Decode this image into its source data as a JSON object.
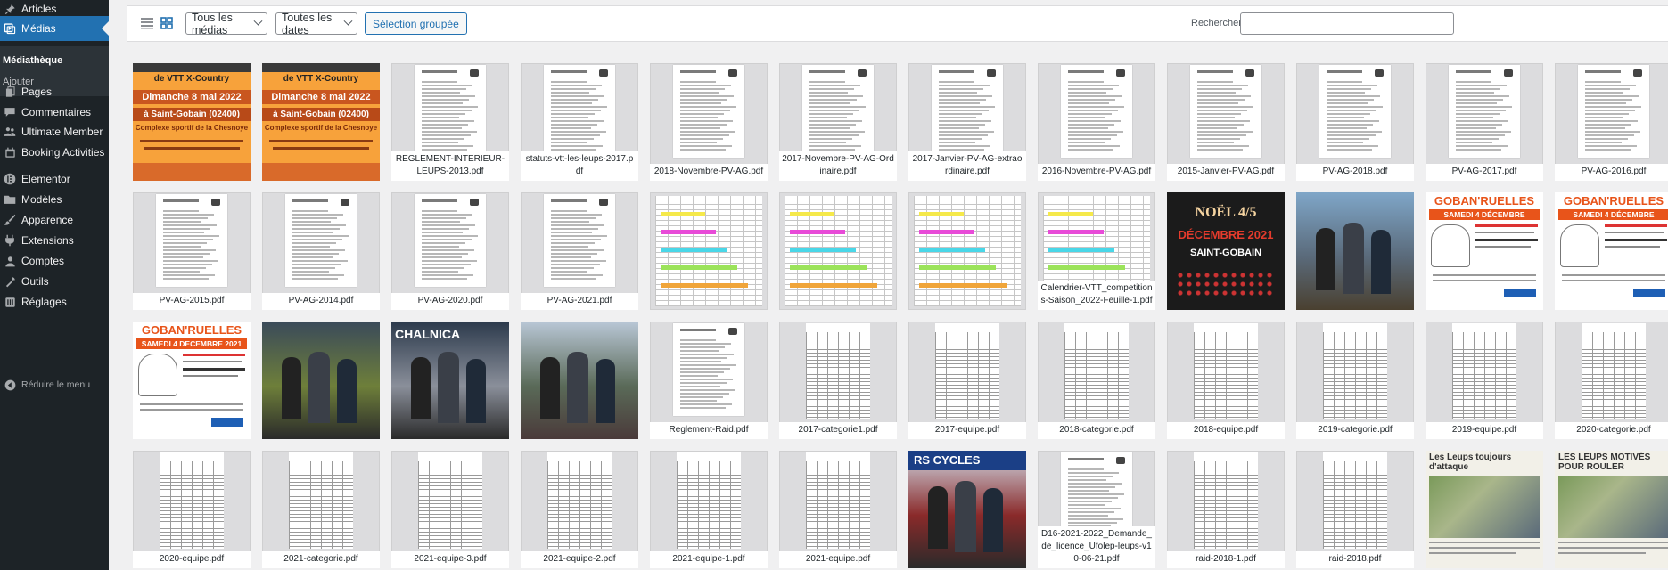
{
  "sidebar": {
    "items": [
      {
        "label": "Articles",
        "icon": "pin-icon",
        "current": false
      },
      {
        "label": "Médias",
        "icon": "media-icon",
        "current": true
      },
      {
        "label": "Pages",
        "icon": "pages-icon",
        "current": false
      },
      {
        "label": "Commentaires",
        "icon": "comments-icon",
        "current": false
      },
      {
        "label": "Ultimate Member",
        "icon": "users-icon",
        "current": false
      },
      {
        "label": "Booking Activities",
        "icon": "calendar-icon",
        "current": false
      },
      {
        "label": "Elementor",
        "icon": "elementor-icon",
        "current": false
      },
      {
        "label": "Modèles",
        "icon": "folder-icon",
        "current": false
      },
      {
        "label": "Apparence",
        "icon": "brush-icon",
        "current": false
      },
      {
        "label": "Extensions",
        "icon": "plugin-icon",
        "current": false
      },
      {
        "label": "Comptes",
        "icon": "user-icon",
        "current": false
      },
      {
        "label": "Outils",
        "icon": "wrench-icon",
        "current": false
      },
      {
        "label": "Réglages",
        "icon": "settings-icon",
        "current": false
      }
    ],
    "submenu": {
      "library": "Médiathèque",
      "add": "Ajouter"
    },
    "collapse": {
      "label": "Réduire le menu",
      "icon": "collapse-icon"
    }
  },
  "toolbar": {
    "type_filter": "Tous les médias",
    "date_filter": "Toutes les dates",
    "bulk_select": "Sélection groupée",
    "search_label": "Rechercher",
    "search_value": ""
  },
  "media": [
    {
      "filename": "",
      "kind": "poster-orange",
      "poster_title": "de VTT X-Country",
      "poster_date": "Dimanche 8 mai 2022",
      "poster_place": "à Saint-Gobain (02400)",
      "poster_sub": "Complexe sportif de la Chesnoye"
    },
    {
      "filename": "",
      "kind": "poster-orange",
      "poster_title": "de VTT X-Country",
      "poster_date": "Dimanche 8 mai 2022",
      "poster_place": "à Saint-Gobain (02400)",
      "poster_sub": "Complexe sportif de la Chesnoye"
    },
    {
      "filename": "REGLEMENT-INTERIEUR-LEUPS-2013.pdf",
      "kind": "doc"
    },
    {
      "filename": "statuts-vtt-les-leups-2017.pdf",
      "kind": "doc"
    },
    {
      "filename": "2018-Novembre-PV-AG.pdf",
      "kind": "doc"
    },
    {
      "filename": "2017-Novembre-PV-AG-Ordinaire.pdf",
      "kind": "doc"
    },
    {
      "filename": "2017-Janvier-PV-AG-extraordinaire.pdf",
      "kind": "doc"
    },
    {
      "filename": "2016-Novembre-PV-AG.pdf",
      "kind": "doc"
    },
    {
      "filename": "2015-Janvier-PV-AG.pdf",
      "kind": "doc"
    },
    {
      "filename": "PV-AG-2018.pdf",
      "kind": "doc"
    },
    {
      "filename": "PV-AG-2017.pdf",
      "kind": "doc"
    },
    {
      "filename": "PV-AG-2016.pdf",
      "kind": "doc"
    },
    {
      "filename": "PV-AG-2015.pdf",
      "kind": "doc"
    },
    {
      "filename": "PV-AG-2014.pdf",
      "kind": "doc"
    },
    {
      "filename": "PV-AG-2020.pdf",
      "kind": "doc"
    },
    {
      "filename": "PV-AG-2021.pdf",
      "kind": "doc"
    },
    {
      "filename": "",
      "kind": "calendar"
    },
    {
      "filename": "",
      "kind": "calendar"
    },
    {
      "filename": "",
      "kind": "calendar"
    },
    {
      "filename": "Calendrier-VTT_competitions-Saison_2022-Feuille-1.pdf",
      "kind": "calendar"
    },
    {
      "filename": "",
      "kind": "poster-noel",
      "poster_title": "NOËL 4/5",
      "poster_date": "DÉCEMBRE 2021",
      "poster_place": "SAINT-GOBAIN"
    },
    {
      "filename": "",
      "kind": "photo-a"
    },
    {
      "filename": "",
      "kind": "poster-goban",
      "poster_title": "GOBAN'RUELLES",
      "poster_date": "SAMEDI 4 DÉCEMBRE"
    },
    {
      "filename": "",
      "kind": "poster-goban",
      "poster_title": "GOBAN'RUELLES",
      "poster_date": "SAMEDI 4 DÉCEMBRE"
    },
    {
      "filename": "",
      "kind": "poster-goban",
      "poster_title": "GOBAN'RUELLES",
      "poster_date": "SAMEDI 4 DECEMBRE 2021"
    },
    {
      "filename": "",
      "kind": "photo-b"
    },
    {
      "filename": "",
      "kind": "photo-c",
      "poster_title": "CHALNICA"
    },
    {
      "filename": "",
      "kind": "photo-d"
    },
    {
      "filename": "Reglement-Raid.pdf",
      "kind": "doc"
    },
    {
      "filename": "2017-categorie1.pdf",
      "kind": "table"
    },
    {
      "filename": "2017-equipe.pdf",
      "kind": "table"
    },
    {
      "filename": "2018-categorie.pdf",
      "kind": "table"
    },
    {
      "filename": "2018-equipe.pdf",
      "kind": "table"
    },
    {
      "filename": "2019-categorie.pdf",
      "kind": "table"
    },
    {
      "filename": "2019-equipe.pdf",
      "kind": "table"
    },
    {
      "filename": "2020-categorie.pdf",
      "kind": "table"
    },
    {
      "filename": "2020-equipe.pdf",
      "kind": "table"
    },
    {
      "filename": "2021-categorie.pdf",
      "kind": "table"
    },
    {
      "filename": "2021-equipe-3.pdf",
      "kind": "table"
    },
    {
      "filename": "2021-equipe-2.pdf",
      "kind": "table"
    },
    {
      "filename": "2021-equipe-1.pdf",
      "kind": "table"
    },
    {
      "filename": "2021-equipe.pdf",
      "kind": "table"
    },
    {
      "filename": "",
      "kind": "photo-e",
      "poster_title": "RS CYCLES"
    },
    {
      "filename": "D16-2021-2022_Demande_de_licence_Ufolep-leups-v10-06-21.pdf",
      "kind": "doc"
    },
    {
      "filename": "raid-2018-1.pdf",
      "kind": "table"
    },
    {
      "filename": "raid-2018.pdf",
      "kind": "table"
    },
    {
      "filename": "",
      "kind": "press",
      "poster_title": "Les Leups toujours d'attaque"
    },
    {
      "filename": "",
      "kind": "press",
      "poster_title": "LES LEUPS MOTIVÉS POUR ROULER"
    }
  ]
}
